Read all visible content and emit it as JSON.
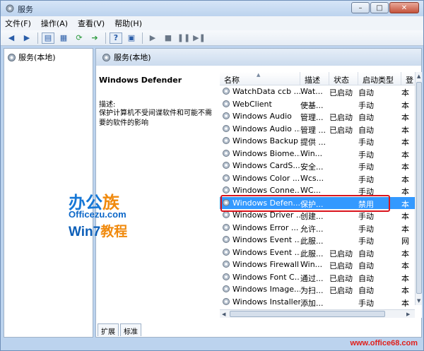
{
  "window": {
    "title": "服务",
    "min": "–",
    "max": "□",
    "close": "✕"
  },
  "menu": [
    "文件(F)",
    "操作(A)",
    "查看(V)",
    "帮助(H)"
  ],
  "toolbar": {
    "help": "?"
  },
  "tree": {
    "label": "服务(本地)"
  },
  "header": {
    "label": "服务(本地)"
  },
  "description": {
    "title": "Windows Defender",
    "label": "描述:",
    "text": "保护计算机不受间谍软件和可能不需要的软件的影响"
  },
  "columns": [
    "名称",
    "描述",
    "状态",
    "启动类型",
    "登"
  ],
  "rows": [
    {
      "name": "WatchData ccb ...",
      "desc": "Wat...",
      "status": "已启动",
      "start": "自动",
      "logon": "本"
    },
    {
      "name": "WebClient",
      "desc": "使基...",
      "status": "",
      "start": "手动",
      "logon": "本"
    },
    {
      "name": "Windows Audio",
      "desc": "管理...",
      "status": "已启动",
      "start": "自动",
      "logon": "本"
    },
    {
      "name": "Windows Audio ...",
      "desc": "管理 ...",
      "status": "已启动",
      "start": "自动",
      "logon": "本"
    },
    {
      "name": "Windows Backup",
      "desc": "提供 ...",
      "status": "",
      "start": "手动",
      "logon": "本"
    },
    {
      "name": "Windows Biome...",
      "desc": "Win...",
      "status": "",
      "start": "手动",
      "logon": "本"
    },
    {
      "name": "Windows CardS...",
      "desc": "安全...",
      "status": "",
      "start": "手动",
      "logon": "本"
    },
    {
      "name": "Windows Color ...",
      "desc": "Wcs...",
      "status": "",
      "start": "手动",
      "logon": "本"
    },
    {
      "name": "Windows Conne...",
      "desc": "WC...",
      "status": "",
      "start": "手动",
      "logon": "本"
    },
    {
      "name": "Windows Defen...",
      "desc": "保护...",
      "status": "",
      "start": "禁用",
      "logon": "本",
      "selected": true
    },
    {
      "name": "Windows Driver ...",
      "desc": "创建...",
      "status": "",
      "start": "手动",
      "logon": "本"
    },
    {
      "name": "Windows Error ...",
      "desc": "允许...",
      "status": "",
      "start": "手动",
      "logon": "本"
    },
    {
      "name": "Windows Event ...",
      "desc": "此服...",
      "status": "",
      "start": "手动",
      "logon": "网"
    },
    {
      "name": "Windows Event ...",
      "desc": "此服...",
      "status": "已启动",
      "start": "自动",
      "logon": "本"
    },
    {
      "name": "Windows Firewall",
      "desc": "Win...",
      "status": "已启动",
      "start": "自动",
      "logon": "本"
    },
    {
      "name": "Windows Font C...",
      "desc": "通过...",
      "status": "已启动",
      "start": "自动",
      "logon": "本"
    },
    {
      "name": "Windows Image...",
      "desc": "为扫...",
      "status": "已启动",
      "start": "自动",
      "logon": "本"
    },
    {
      "name": "Windows Installer",
      "desc": "添加...",
      "status": "",
      "start": "手动",
      "logon": "本"
    }
  ],
  "tabs": [
    "扩展",
    "标准"
  ],
  "watermark": {
    "line1_a": "办公",
    "line1_b": "族",
    "line2": "Officezu.com",
    "line3_a": "Win7",
    "line3_b": "教程",
    "url": "www.office68.com"
  },
  "colors": {
    "selection": "#3399ff",
    "highlight_border": "#d9141c"
  }
}
